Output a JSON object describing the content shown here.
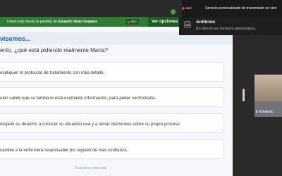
{
  "top_bar": {
    "share_prefix": "Usted está viendo la pantalla de",
    "share_name": "Eduardo Velez Grajales",
    "rec_label": "REC",
    "transmission_text": "Servicio personalizado de transmisión en vivo"
  },
  "green_strip": {
    "message": "Usted está viendo la pantalla de",
    "name": "Eduardo Velez Grajales",
    "rec_label": "REC",
    "view_options": "Ver opciones"
  },
  "notification": {
    "badge": "HD",
    "title": "Anfitrión",
    "subtitle": "En directo en Servicio personaliza"
  },
  "content": {
    "heading": "visemos...",
    "question": "ento, ¿qué está pidiendo realmente María?",
    "options": [
      "expliquen el protocolo de tratamiento con más detalle.",
      "uien valide que su familia le está ocultando información, para poder confrontarla.",
      "respete su derecho a conocer su situación real y a tomar decisiones sobre su propio proceso.",
      "cambie a la enfermera responsable por alguien de más confianza."
    ],
    "save_note": "Guarda tu respuesta"
  },
  "video_tile": {
    "name": "Eduardo"
  },
  "colors": {
    "accent": "#1565c0",
    "share_green": "#2e7d32",
    "rec_red": "#e53935"
  }
}
